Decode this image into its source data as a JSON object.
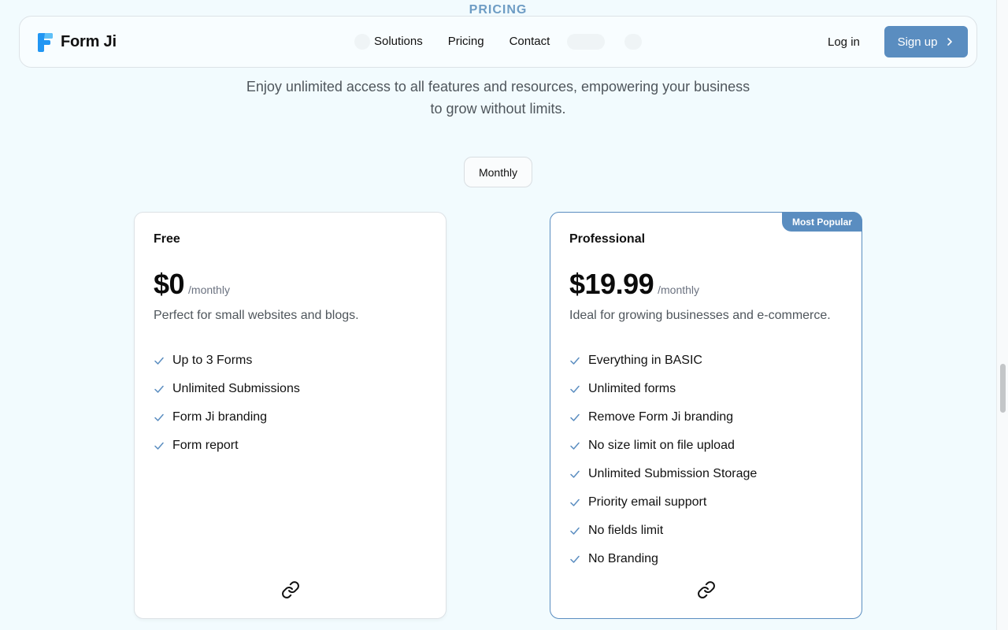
{
  "section": {
    "eyebrow": "PRICING"
  },
  "navbar": {
    "brand": "Form Ji",
    "links": [
      "Solutions",
      "Pricing",
      "Contact"
    ],
    "login": "Log in",
    "signup": "Sign up"
  },
  "description": {
    "line1": "Enjoy unlimited access to all features and resources, empowering your business",
    "line2": "to grow without limits."
  },
  "billing_toggle": {
    "label": "Monthly"
  },
  "plans": [
    {
      "name": "Free",
      "price": "$0",
      "period": "/monthly",
      "description": "Perfect for small websites and blogs.",
      "features": [
        "Up to 3 Forms",
        "Unlimited Submissions",
        "Form Ji branding",
        "Form report"
      ],
      "icon": "link-icon"
    },
    {
      "name": "Professional",
      "badge": "Most Popular",
      "price": "$19.99",
      "period": "/monthly",
      "description": "Ideal for growing businesses and e-commerce.",
      "features": [
        "Everything in BASIC",
        "Unlimited forms",
        "Remove Form Ji branding",
        "No size limit on file upload",
        "Unlimited Submission Storage",
        "Priority email support",
        "No fields limit",
        "No Branding"
      ],
      "icon": "link-icon"
    }
  ],
  "colors": {
    "accent": "#5a8dc0",
    "background": "#f2fbfe",
    "eyebrow": "#6d9cc4"
  }
}
